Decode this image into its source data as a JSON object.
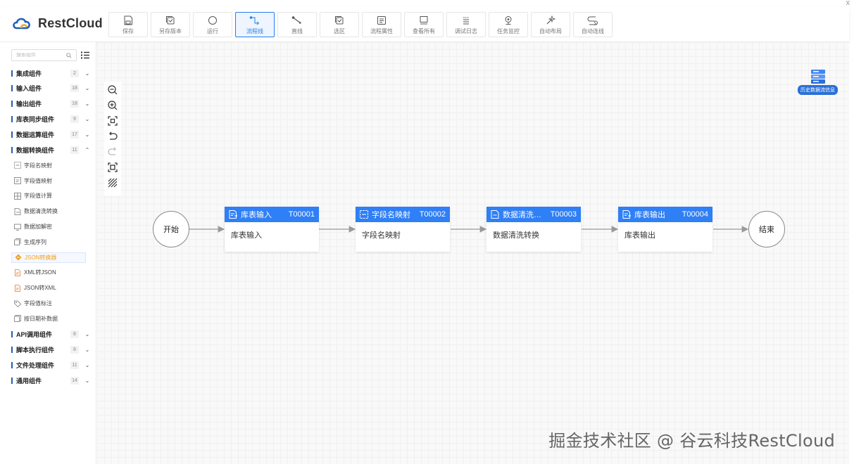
{
  "window": {
    "close_glyph": "x"
  },
  "brand": {
    "name": "RestCloud"
  },
  "toolbar": [
    {
      "label": "保存",
      "icon": "save-icon",
      "active": false
    },
    {
      "label": "另存版本",
      "icon": "save-version-icon",
      "active": false
    },
    {
      "label": "运行",
      "icon": "run-icon",
      "active": false
    },
    {
      "label": "流程线",
      "icon": "flow-line-icon",
      "active": true
    },
    {
      "label": "直线",
      "icon": "straight-line-icon",
      "active": false
    },
    {
      "label": "选区",
      "icon": "select-area-icon",
      "active": false
    },
    {
      "label": "流程属性",
      "icon": "flow-properties-icon",
      "active": false
    },
    {
      "label": "查看所有",
      "icon": "view-all-icon",
      "active": false
    },
    {
      "label": "调试日志",
      "icon": "debug-log-icon",
      "active": false
    },
    {
      "label": "任务监控",
      "icon": "task-monitor-icon",
      "active": false
    },
    {
      "label": "自动布局",
      "icon": "auto-layout-icon",
      "active": false
    },
    {
      "label": "自动连线",
      "icon": "auto-connect-icon",
      "active": false
    }
  ],
  "sidebar": {
    "search_placeholder": "搜索组件",
    "categories_top": [
      {
        "name": "集成组件",
        "count": "2",
        "chevron": "⌄"
      },
      {
        "name": "输入组件",
        "count": "18",
        "chevron": "⌄"
      },
      {
        "name": "输出组件",
        "count": "18",
        "chevron": "⌄"
      },
      {
        "name": "库表同步组件",
        "count": "9",
        "chevron": "⌄"
      },
      {
        "name": "数据运算组件",
        "count": "17",
        "chevron": "⌄"
      },
      {
        "name": "数据转换组件",
        "count": "11",
        "chevron": "⌃"
      }
    ],
    "sub_items": [
      {
        "name": "字段名映射",
        "icon": "field-map-icon",
        "selected": false
      },
      {
        "name": "字段值映射",
        "icon": "value-map-icon",
        "selected": false
      },
      {
        "name": "字段值计算",
        "icon": "calc-icon",
        "selected": false
      },
      {
        "name": "数据清洗转换",
        "icon": "clean-icon",
        "selected": false
      },
      {
        "name": "数据加解密",
        "icon": "encrypt-icon",
        "selected": false
      },
      {
        "name": "生成序列",
        "icon": "sequence-icon",
        "selected": false
      },
      {
        "name": "JSON转换器",
        "icon": "json-converter-icon",
        "selected": true
      },
      {
        "name": "XML转JSON",
        "icon": "xml-json-icon",
        "selected": false
      },
      {
        "name": "JSON转XML",
        "icon": "json-xml-icon",
        "selected": false
      },
      {
        "name": "字段值标注",
        "icon": "tag-icon",
        "selected": false
      },
      {
        "name": "按日期补数据",
        "icon": "date-fill-icon",
        "selected": false
      }
    ],
    "categories_bottom": [
      {
        "name": "API调用组件",
        "count": "8",
        "chevron": "⌄"
      },
      {
        "name": "脚本执行组件",
        "count": "8",
        "chevron": "⌄"
      },
      {
        "name": "文件处理组件",
        "count": "11",
        "chevron": "⌄"
      },
      {
        "name": "通用组件",
        "count": "14",
        "chevron": "⌄"
      }
    ]
  },
  "canvas": {
    "history_label": "历史数据流信息",
    "start_label": "开始",
    "end_label": "结束",
    "nodes": [
      {
        "title": "库表输入",
        "id": "T00001",
        "body": "库表输入",
        "icon": "table-input-icon"
      },
      {
        "title": "字段名映射",
        "id": "T00002",
        "body": "字段名映射",
        "icon": "field-map-icon"
      },
      {
        "title": "数据清洗…",
        "id": "T00003",
        "body": "数据清洗转换",
        "icon": "clean-icon"
      },
      {
        "title": "库表输出",
        "id": "T00004",
        "body": "库表输出",
        "icon": "table-output-icon"
      }
    ]
  },
  "watermark": "掘金技术社区 @ 谷云科技RestCloud",
  "colors": {
    "primary": "#2f7ff6",
    "accent_bar": "#1f5fb4",
    "selected_text": "#f0a020"
  }
}
